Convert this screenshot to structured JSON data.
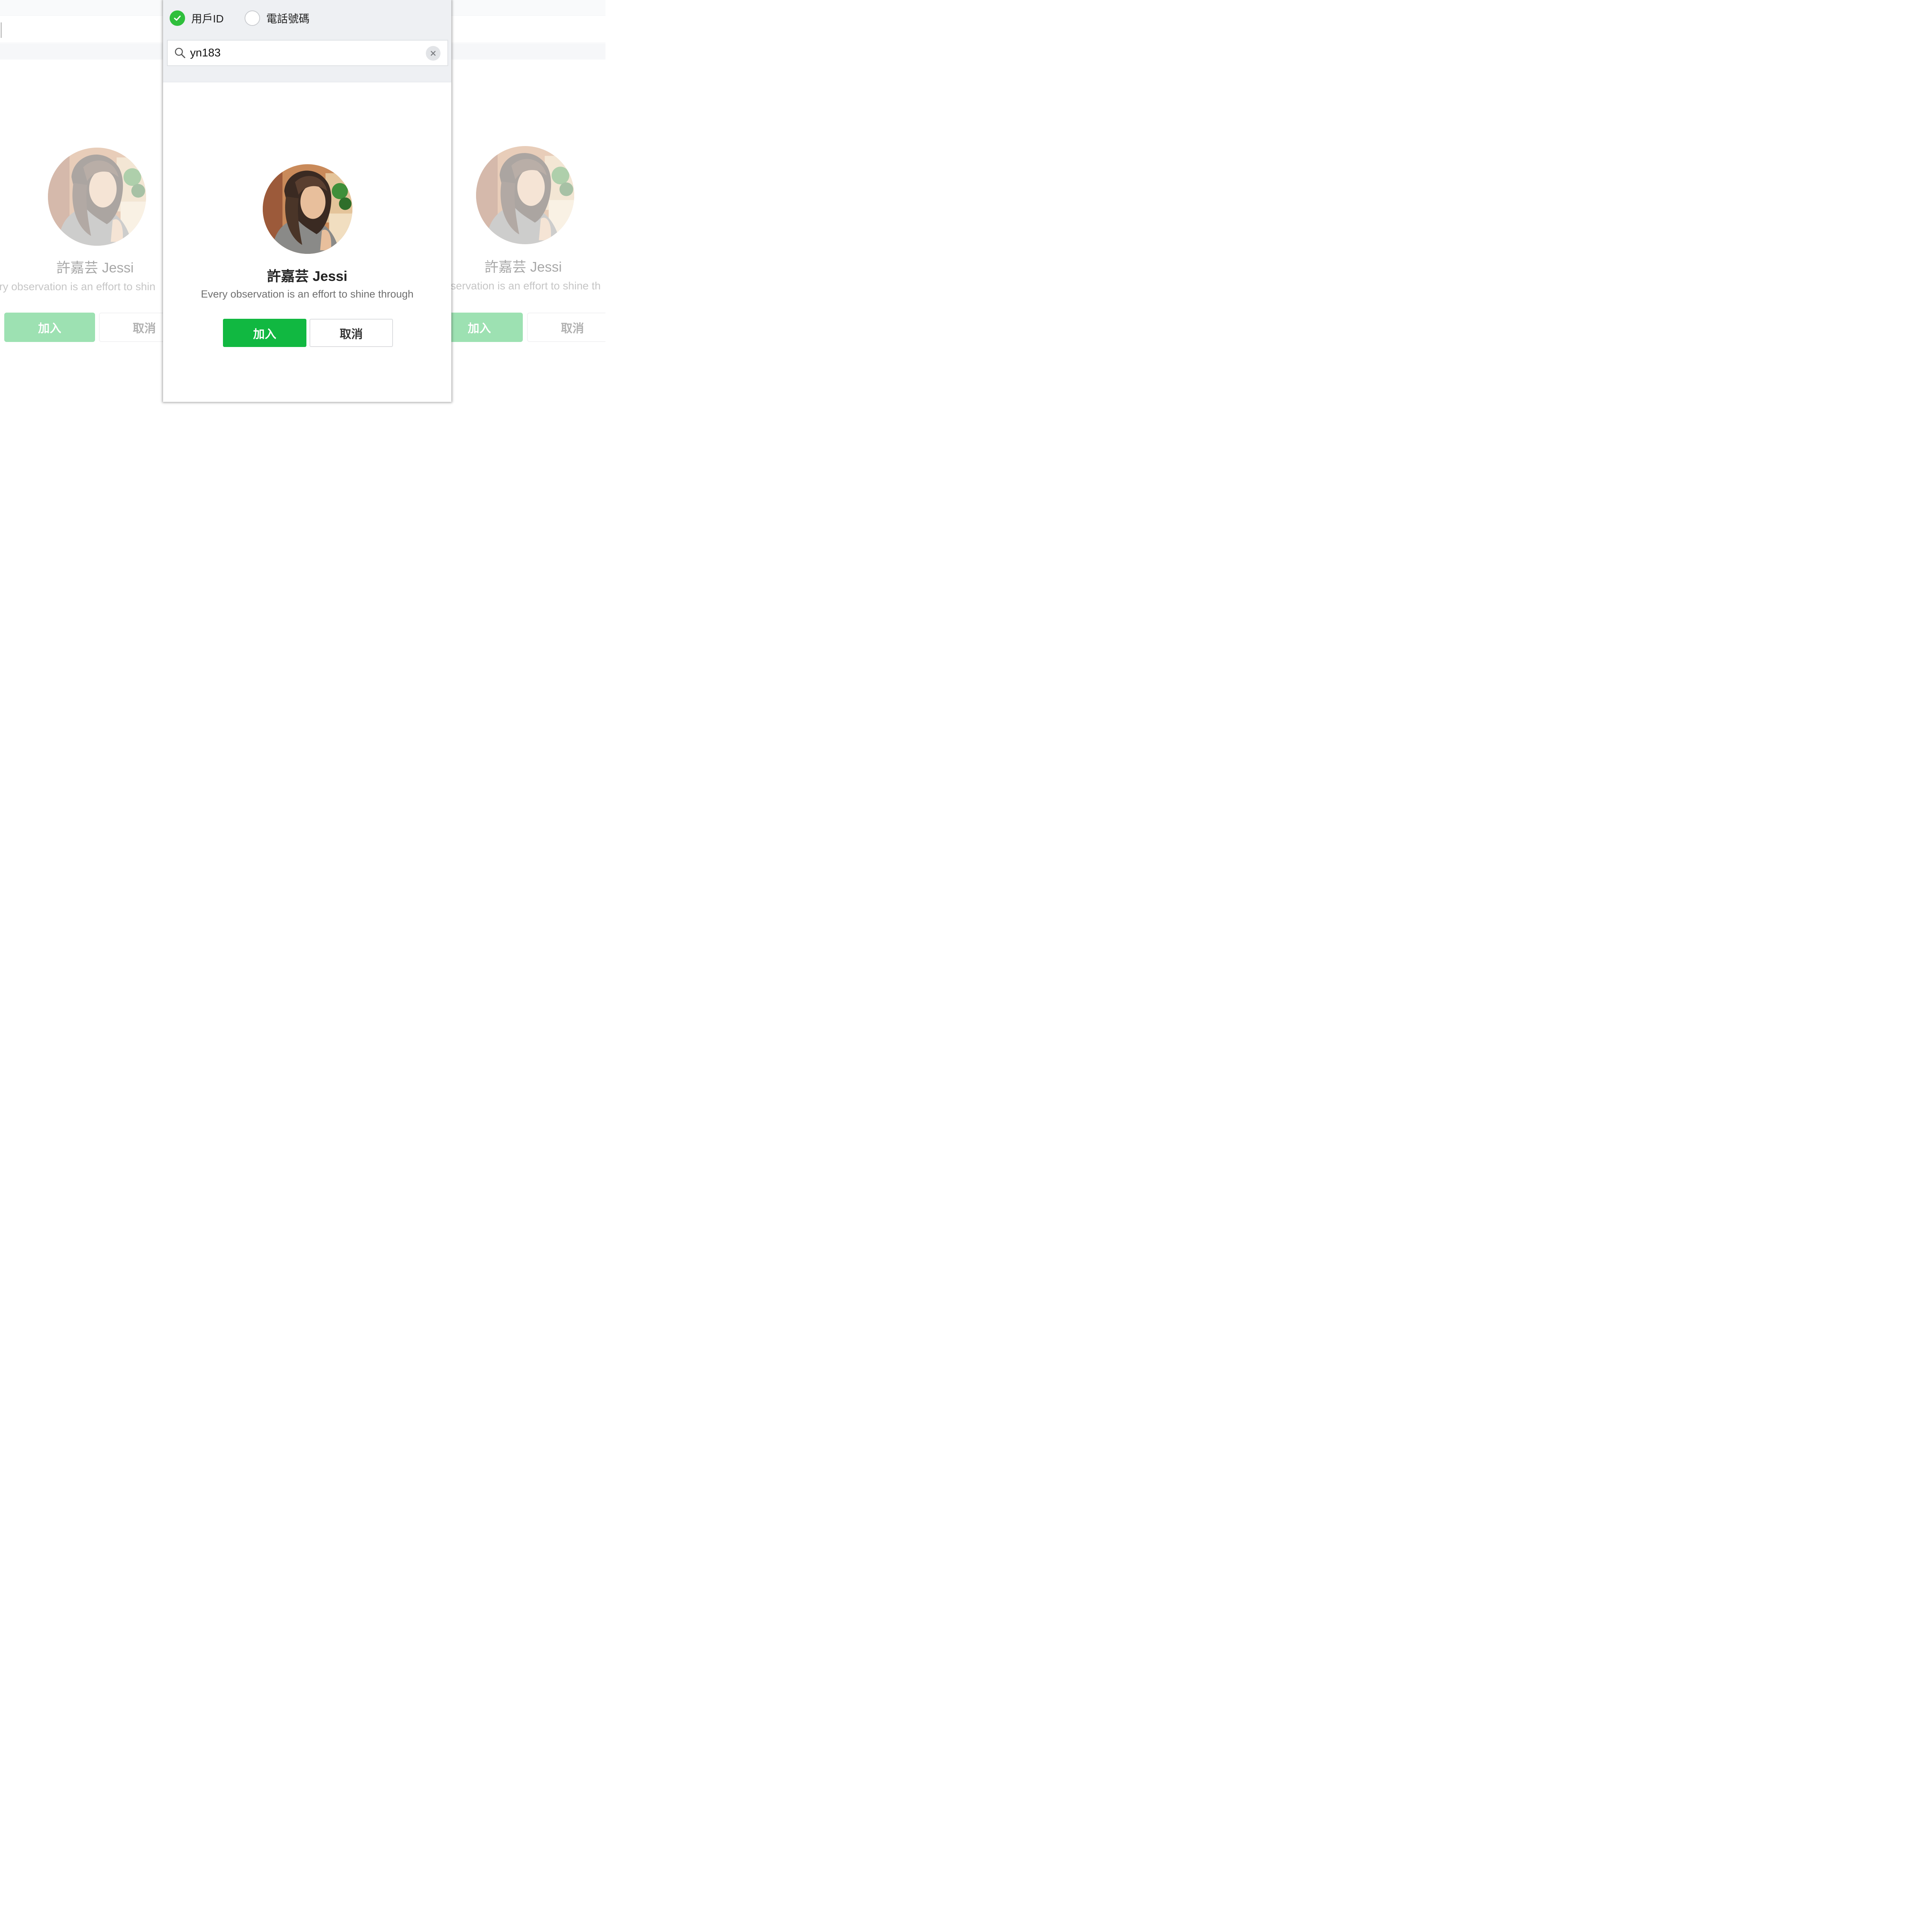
{
  "search_type": {
    "options": [
      {
        "label": "用戶ID",
        "selected": true
      },
      {
        "label": "電話號碼",
        "selected": false
      }
    ]
  },
  "search": {
    "value": "yn183"
  },
  "result": {
    "name": "許嘉芸 Jessi",
    "status_message": "Every observation is an effort to shine through",
    "avatar_icon": "user-photo-avatar"
  },
  "actions": {
    "add_label": "加入",
    "cancel_label": "取消"
  },
  "background_left": {
    "status_fragment": "ry observation is an effort to shin"
  },
  "background_right": {
    "status_fragment": "servation is an effort to shine th"
  },
  "colors": {
    "accent_green": "#11b841",
    "check_green": "#2fbf3c"
  }
}
